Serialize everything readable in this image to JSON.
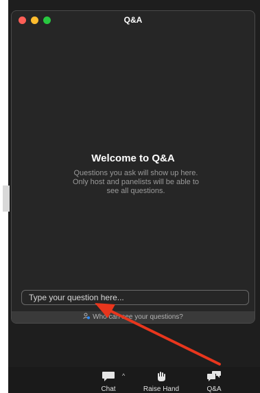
{
  "window": {
    "title": "Q&A"
  },
  "welcome": {
    "title": "Welcome to Q&A",
    "description": "Questions you ask will show up here. Only host and panelists will be able to see all questions."
  },
  "question_input": {
    "placeholder": "Type your question here..."
  },
  "visibility": {
    "label": "Who can see your questions?",
    "icon": "person-icon"
  },
  "toolbar": {
    "chat_label": "Chat",
    "raise_hand_label": "Raise Hand",
    "qa_label": "Q&A"
  },
  "colors": {
    "window_bg": "#262626",
    "meeting_bg": "#1e1e1e",
    "annotation_arrow": "#e8361d"
  }
}
